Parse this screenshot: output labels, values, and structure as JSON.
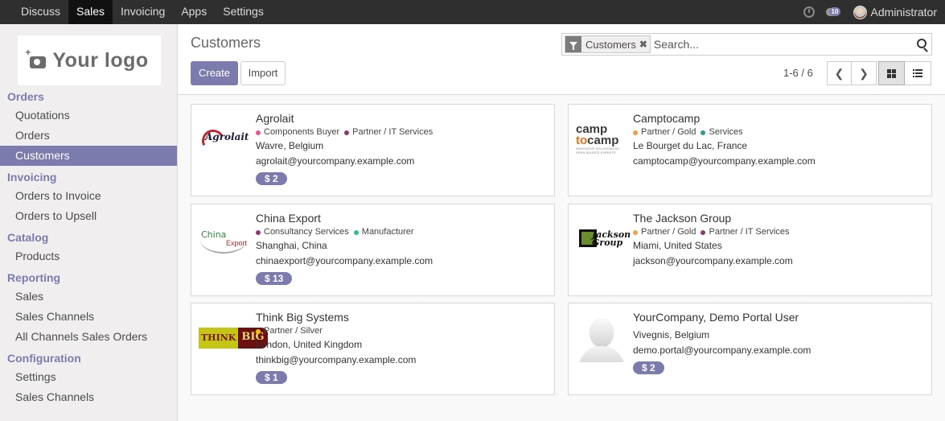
{
  "topbar": {
    "menu": [
      "Discuss",
      "Sales",
      "Invoicing",
      "Apps",
      "Settings"
    ],
    "active": "Sales",
    "chat_count": "10",
    "user": "Administrator"
  },
  "sidebar": {
    "logo_text": "Your logo",
    "sections": [
      {
        "title": "Orders",
        "items": [
          "Quotations",
          "Orders",
          "Customers"
        ]
      },
      {
        "title": "Invoicing",
        "items": [
          "Orders to Invoice",
          "Orders to Upsell"
        ]
      },
      {
        "title": "Catalog",
        "items": [
          "Products"
        ]
      },
      {
        "title": "Reporting",
        "items": [
          "Sales",
          "Sales Channels",
          "All Channels Sales Orders"
        ]
      },
      {
        "title": "Configuration",
        "items": [
          "Settings",
          "Sales Channels"
        ]
      }
    ],
    "active_item": "Customers"
  },
  "control": {
    "breadcrumb": "Customers",
    "create_label": "Create",
    "import_label": "Import",
    "facet_label": "Customers",
    "search_placeholder": "Search...",
    "pager": "1-6 / 6"
  },
  "colors": {
    "accent": "#7c7bad",
    "tag_pink": "#e4578c",
    "tag_purple": "#8a3c6e",
    "tag_orange": "#f0a04b",
    "tag_teal": "#2f9b91",
    "tag_green": "#30c381",
    "tag_yellow": "#f4c20d"
  },
  "customers": [
    {
      "name": "Agrolait",
      "logo": "agrolait-logo",
      "tags": [
        {
          "label": "Components Buyer",
          "color": "#e4578c"
        },
        {
          "label": "Partner / IT Services",
          "color": "#8a3c6e"
        }
      ],
      "location": "Wavre, Belgium",
      "email": "agrolait@yourcompany.example.com",
      "badge": "$ 2"
    },
    {
      "name": "Camptocamp",
      "logo": "camptocamp-logo",
      "tags": [
        {
          "label": "Partner / Gold",
          "color": "#f0a04b"
        },
        {
          "label": "Services",
          "color": "#2f9b91"
        }
      ],
      "location": "Le Bourget du Lac, France",
      "email": "camptocamp@yourcompany.example.com",
      "badge": ""
    },
    {
      "name": "China Export",
      "logo": "china-export-logo",
      "tags": [
        {
          "label": "Consultancy Services",
          "color": "#8a3c6e"
        },
        {
          "label": "Manufacturer",
          "color": "#30c381"
        }
      ],
      "location": "Shanghai, China",
      "email": "chinaexport@yourcompany.example.com",
      "badge": "$ 13"
    },
    {
      "name": "The Jackson Group",
      "logo": "jackson-group-logo",
      "tags": [
        {
          "label": "Partner / Gold",
          "color": "#f0a04b"
        },
        {
          "label": "Partner / IT Services",
          "color": "#8a3c6e"
        }
      ],
      "location": "Miami, United States",
      "email": "jackson@yourcompany.example.com",
      "badge": ""
    },
    {
      "name": "Think Big Systems",
      "logo": "think-big-logo",
      "tags": [
        {
          "label": "Partner / Silver",
          "color": "#f4c20d"
        }
      ],
      "location": "London, United Kingdom",
      "email": "thinkbig@yourcompany.example.com",
      "badge": "$ 1"
    },
    {
      "name": "YourCompany, Demo Portal User",
      "logo": "person-placeholder-icon",
      "tags": [],
      "location": "Vivegnis, Belgium",
      "email": "demo.portal@yourcompany.example.com",
      "badge": "$ 2"
    }
  ],
  "logo_text": {
    "agrolait": "Agrolait",
    "camp1": "camp",
    "camp2": "to",
    "camp3": "camp",
    "camp_sub": "INNOVATIVE SOLUTIONS BY OPEN SOURCE EXPERTS",
    "china1": "China",
    "china2": "Export",
    "jackson": "Jackson Group",
    "think1": "THINK",
    "think2": "BIG"
  }
}
